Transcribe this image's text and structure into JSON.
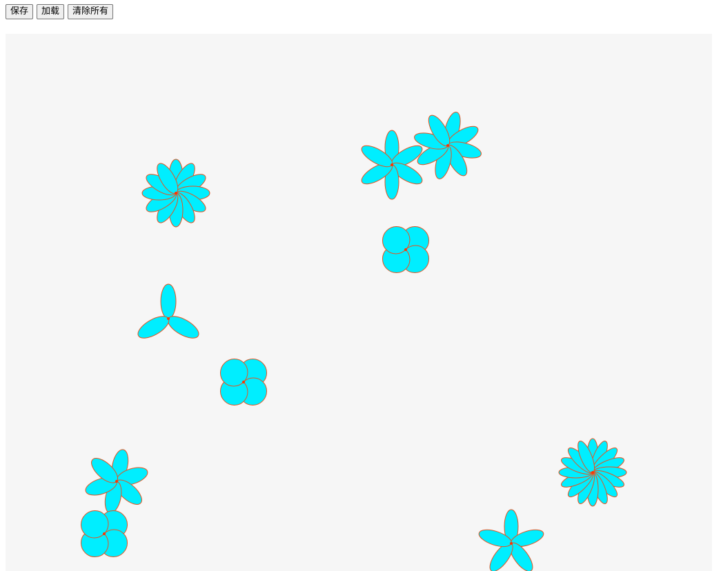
{
  "toolbar": {
    "save_label": "保存",
    "load_label": "加载",
    "clear_label": "清除所有"
  },
  "canvas": {
    "background_color": "#f6f6f6",
    "petal_fill": "#00eeff",
    "petal_stroke": "#e6531f",
    "center_color": "#ff3300"
  },
  "flowers": [
    {
      "petals": 12,
      "petal_length": 49,
      "petal_width": 10
    },
    {
      "petals": 6,
      "petal_length": 50,
      "petal_width": 10
    },
    {
      "petals": 8,
      "petal_length": 50,
      "petal_width": 10
    },
    {
      "petals": 4,
      "petal_length": 39,
      "petal_width": 20
    },
    {
      "petals": 3,
      "petal_length": 50,
      "petal_width": 11
    },
    {
      "petals": 4,
      "petal_length": 39,
      "petal_width": 20
    },
    {
      "petals": 6,
      "petal_length": 47,
      "petal_width": 11
    },
    {
      "petals": 4,
      "petal_length": 39,
      "petal_width": 20
    },
    {
      "petals": 16,
      "petal_length": 49,
      "petal_width": 8
    },
    {
      "petals": 5,
      "petal_length": 49,
      "petal_width": 10
    }
  ]
}
